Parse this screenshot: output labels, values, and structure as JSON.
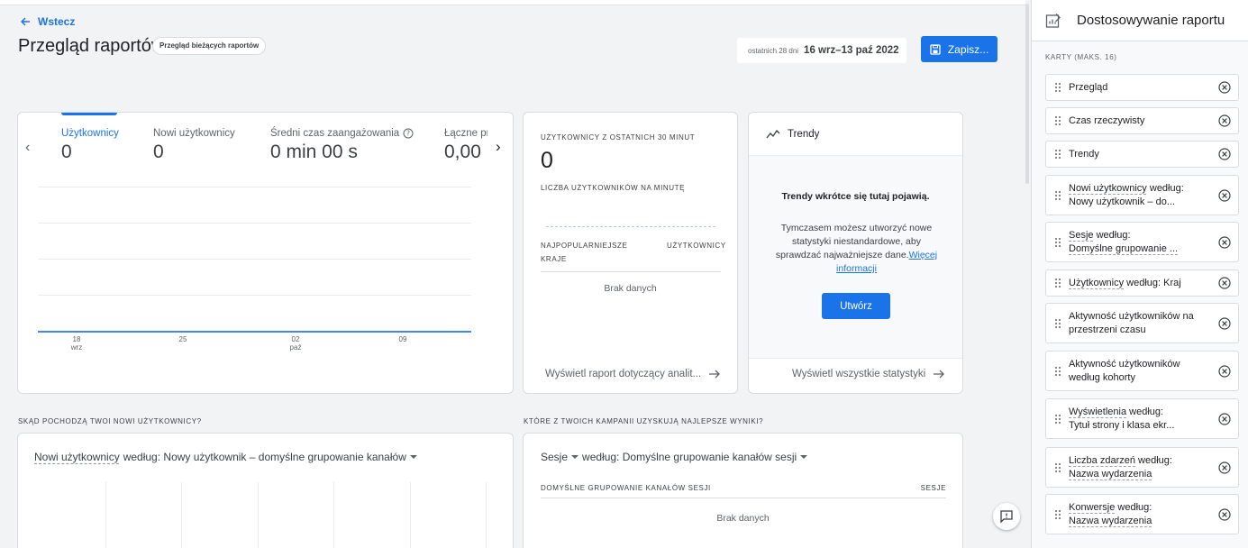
{
  "nav": {
    "back_label": "Wstecz"
  },
  "header": {
    "title": "Przegląd raportów",
    "chip": "Przegląd bieżących raportów",
    "range_prefix": "ostatnich 28 dni",
    "range_dates": "16 wrz–13 paź 2022",
    "save_label": "Zapisz..."
  },
  "metrics": [
    {
      "label": "Użytkownicy",
      "value": "0"
    },
    {
      "label": "Nowi użytkownicy",
      "value": "0"
    },
    {
      "label": "Średni czas zaangażowania",
      "value": "0 min 00 s"
    },
    {
      "label": "Łączne pr",
      "value": "0,00"
    }
  ],
  "chart_data": {
    "type": "line",
    "x_ticks": [
      {
        "day": "18",
        "month": "wrz"
      },
      {
        "day": "25",
        "month": ""
      },
      {
        "day": "02",
        "month": "paź"
      },
      {
        "day": "09",
        "month": ""
      }
    ],
    "series": [
      {
        "values": [
          0,
          0,
          0,
          0
        ]
      }
    ]
  },
  "realtime": {
    "caption": "UŻYTKOWNICY Z OSTATNICH 30 MINUT",
    "value": "0",
    "per_minute_caption": "LICZBA UŻYTKOWNIKÓW NA MINUTĘ",
    "col1": "NAJPOPULARNIEJSZE KRAJE",
    "col2": "UŻYTKOWNICY",
    "empty": "Brak danych",
    "link": "Wyświetl raport dotyczący analit..."
  },
  "trends": {
    "title": "Trendy",
    "bold": "Trendy wkrótce się tutaj pojawią.",
    "text": "Tymczasem możesz utworzyć nowe statystyki niestandardowe, aby sprawdzać najważniejsze dane.",
    "link": "Więcej informacji",
    "button": "Utwórz",
    "footer_link": "Wyświetl wszystkie statystyki"
  },
  "section1": {
    "heading": "SKĄD POCHODZĄ TWOI NOWI UŻYTKOWNICY?",
    "dropdown_metric": "Nowi użytkownicy",
    "dropdown_rest": "według: Nowy użytkownik – domyślne grupowanie kanałów"
  },
  "section2": {
    "heading": "KTÓRE Z TWOICH KAMPANII UZYSKUJĄ NAJLEPSZE WYNIKI?",
    "dropdown_metric": "Sesje",
    "dropdown_rest": "według: Domyślne grupowanie kanałów sesji",
    "col1": "DOMYŚLNE GRUPOWANIE KANAŁÓW SESJI",
    "col2": "SESJE",
    "empty": "Brak danych"
  },
  "panel": {
    "title": "Dostosowywanie raportu",
    "caption": "KARTY (MAKS. 16)",
    "items": [
      {
        "l1": "Przegląd",
        "l2": ""
      },
      {
        "l1": "Czas rzeczywisty",
        "l2": ""
      },
      {
        "l1": "Trendy",
        "l2": ""
      },
      {
        "l1": "Nowi użytkownicy według:",
        "l2": "Nowy użytkownik – do..."
      },
      {
        "l1": "Sesje według:",
        "l2": "Domyślne grupowanie ..."
      },
      {
        "l1": "Użytkownicy według: Kraj",
        "l2": ""
      },
      {
        "l1": "Aktywność użytkowników na",
        "l2": "przestrzeni czasu"
      },
      {
        "l1": "Aktywność użytkowników",
        "l2": "według kohorty"
      },
      {
        "l1": "Wyświetlenia według:",
        "l2": "Tytuł strony i klasa ekr..."
      },
      {
        "l1": "Liczba zdarzeń według:",
        "l2": "Nazwa wydarzenia"
      },
      {
        "l1": "Konwersje według:",
        "l2": "Nazwa wydarzenia"
      }
    ]
  },
  "colors": {
    "accent": "#1a73e8",
    "chart_line": "#4285f4"
  },
  "icons": [
    "arrow-back-icon",
    "save-icon",
    "help-icon",
    "chevron-left-icon",
    "chevron-right-icon",
    "trending-icon",
    "arrow-forward-icon",
    "dropdown-arrow-icon",
    "feedback-icon",
    "customize-icon",
    "drag-handle-icon",
    "remove-icon"
  ]
}
